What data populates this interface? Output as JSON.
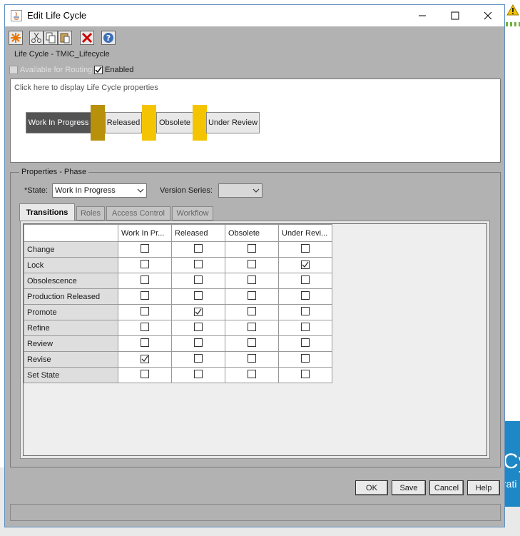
{
  "window": {
    "title": "Edit Life Cycle"
  },
  "toolbar": {
    "buttons": [
      {
        "name": "new",
        "icon": "new-icon"
      },
      {
        "name": "cut",
        "icon": "cut-icon"
      },
      {
        "name": "copy",
        "icon": "copy-icon"
      },
      {
        "name": "paste",
        "icon": "paste-icon"
      },
      {
        "name": "delete",
        "icon": "delete-icon"
      },
      {
        "name": "help",
        "icon": "help-icon"
      }
    ]
  },
  "lifecycle": {
    "label": "Life Cycle - TMIC_Lifecycle",
    "available_for_routing": {
      "label": "Available for Routing",
      "checked": false,
      "disabled": true
    },
    "enabled": {
      "label": "Enabled",
      "checked": true
    },
    "hint": "Click here to display Life Cycle properties",
    "phases": [
      {
        "label": "Work In Progress",
        "active": true
      },
      {
        "label": "Released",
        "active": false
      },
      {
        "label": "Obsolete",
        "active": false
      },
      {
        "label": "Under Review",
        "active": false
      }
    ],
    "phase_bar_colors": [
      "#b8900a",
      "#f5c400",
      "#f5c400"
    ]
  },
  "properties": {
    "legend": "Properties - Phase",
    "state_label": "*State:",
    "state_value": "Work In Progress",
    "version_series_label": "Version Series:",
    "version_series_value": "",
    "tabs": [
      {
        "label": "Transitions",
        "active": true
      },
      {
        "label": "Roles",
        "active": false
      },
      {
        "label": "Access Control",
        "active": false
      },
      {
        "label": "Workflow",
        "active": false
      }
    ]
  },
  "transitions": {
    "columns": [
      "Work In Pr...",
      "Released",
      "Obsolete",
      "Under Revi..."
    ],
    "rows": [
      {
        "label": "Change",
        "checks": [
          false,
          false,
          false,
          false
        ]
      },
      {
        "label": "Lock",
        "checks": [
          false,
          false,
          false,
          true
        ]
      },
      {
        "label": "Obsolescence",
        "checks": [
          false,
          false,
          false,
          false
        ]
      },
      {
        "label": "Production Released",
        "checks": [
          false,
          false,
          false,
          false
        ]
      },
      {
        "label": "Promote",
        "checks": [
          false,
          true,
          false,
          false
        ]
      },
      {
        "label": "Refine",
        "checks": [
          false,
          false,
          false,
          false
        ]
      },
      {
        "label": "Review",
        "checks": [
          false,
          false,
          false,
          false
        ]
      },
      {
        "label": "Revise",
        "checks": [
          true,
          false,
          false,
          false
        ]
      },
      {
        "label": "Set State",
        "checks": [
          false,
          false,
          false,
          false
        ]
      }
    ]
  },
  "buttons": {
    "ok": "OK",
    "save": "Save",
    "cancel": "Cancel",
    "help": "Help"
  },
  "background": {
    "banner_text_1": "Cy",
    "banner_text_2": "rati",
    "banner_color": "#1e88c7"
  }
}
